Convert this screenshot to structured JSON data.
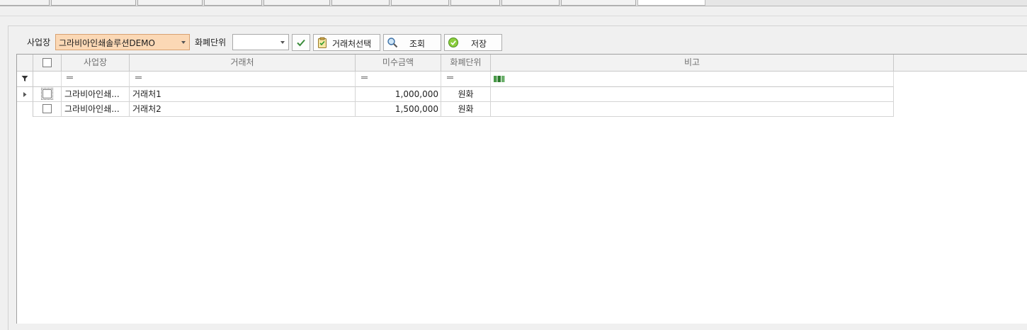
{
  "toolbar": {
    "business_label": "사업장",
    "business_value": "그라비아인쇄솔루션DEMO",
    "currency_label": "화폐단위",
    "currency_value": "",
    "select_client_label": "거래처선택",
    "search_label": "조회",
    "save_label": "저장"
  },
  "grid": {
    "columns": [
      "사업장",
      "거래처",
      "미수금액",
      "화폐단위",
      "비고"
    ],
    "rows": [
      {
        "business": "그라비아인쇄...",
        "client": "거래처1",
        "amount": "1,000,000",
        "currency": "원화",
        "note": ""
      },
      {
        "business": "그라비아인쇄...",
        "client": "거래처2",
        "amount": "1,500,000",
        "currency": "원화",
        "note": ""
      }
    ]
  },
  "icons": [
    "filter-icon",
    "check-icon",
    "clipboard-icon",
    "search-icon",
    "save-icon",
    "text-filter-icon",
    "row-indicator-icon"
  ],
  "colors": {
    "business_combo_bg": "#fbd8b5",
    "accent_green": "#2f9a2f"
  }
}
